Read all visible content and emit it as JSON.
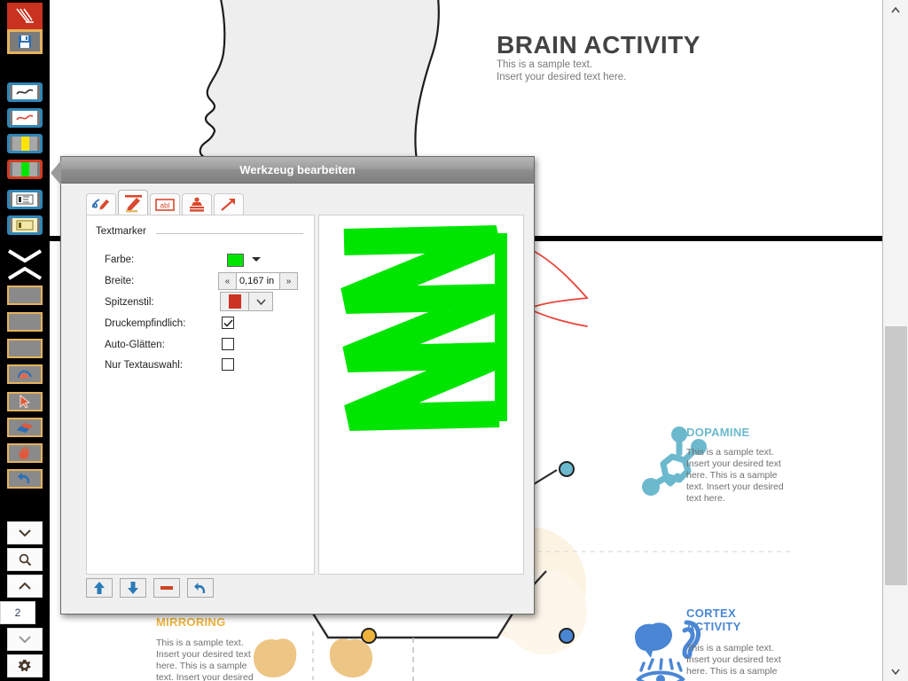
{
  "app": {
    "name": "pdf-annotator",
    "page_number": "2"
  },
  "left_toolbar": {
    "items": [
      {
        "name": "app-logo",
        "icon": "adobe-logo-icon",
        "label": "Adobe",
        "selected": false
      },
      {
        "name": "save-button",
        "icon": "floppy-disk-icon",
        "label": "Speichern",
        "selected": false
      },
      {
        "name": "pen-black-tool",
        "icon": "pen-stroke-icon",
        "label": "Stift schwarz",
        "selected": false
      },
      {
        "name": "pen-red-tool",
        "icon": "pen-stroke-icon",
        "label": "Stift rot",
        "selected": false
      },
      {
        "name": "highlighter-yellow",
        "icon": "highlighter-icon",
        "label": "Textmarker gelb",
        "selected": false
      },
      {
        "name": "highlighter-green",
        "icon": "highlighter-icon",
        "label": "Textmarker grün",
        "selected": true
      },
      {
        "name": "textbox-tool",
        "icon": "text-box-icon",
        "label": "Textfeld",
        "selected": false
      },
      {
        "name": "note-tool",
        "icon": "sticky-note-icon",
        "label": "Notiz",
        "selected": false
      },
      {
        "name": "collapse-up-chevron",
        "icon": "chevron-down-icon",
        "label": "Einklappen",
        "selected": false
      },
      {
        "name": "expand-chevron",
        "icon": "chevron-up-icon",
        "label": "Ausklappen",
        "selected": false
      },
      {
        "name": "tool-slot-1",
        "icon": "blank-tool-icon",
        "label": "Werkzeug",
        "selected": false
      },
      {
        "name": "tool-slot-2",
        "icon": "blank-tool-icon",
        "label": "Werkzeug",
        "selected": false
      },
      {
        "name": "tool-slot-3",
        "icon": "blank-tool-icon",
        "label": "Werkzeug",
        "selected": false
      },
      {
        "name": "pinch-gesture-tool",
        "icon": "pinch-hand-icon",
        "label": "Zoomgeste",
        "selected": false
      },
      {
        "name": "select-cursor-tool",
        "icon": "cursor-arrow-icon",
        "label": "Auswahl",
        "selected": false
      },
      {
        "name": "eraser-tool",
        "icon": "eraser-icon",
        "label": "Radierer",
        "selected": false
      },
      {
        "name": "pan-hand-tool",
        "icon": "hand-icon",
        "label": "Verschieben",
        "selected": false
      },
      {
        "name": "undo-tool",
        "icon": "undo-arrow-icon",
        "label": "Rückgängig",
        "selected": false
      }
    ],
    "bottom_items": [
      {
        "name": "menu-dropdown-button",
        "icon": "chevron-down-icon",
        "label": "Menü"
      },
      {
        "name": "zoom-button",
        "icon": "magnifier-icon",
        "label": "Zoom"
      },
      {
        "name": "page-up-button",
        "icon": "chevron-up-icon",
        "label": "Seite zurück"
      },
      {
        "name": "page-indicator",
        "icon": "page-number",
        "label": "2"
      },
      {
        "name": "page-down-button",
        "icon": "chevron-down-icon",
        "label": "Seite vor"
      },
      {
        "name": "settings-button",
        "icon": "gear-icon",
        "label": "Einstellungen"
      }
    ]
  },
  "document": {
    "title": "BRAIN ACTIVITY",
    "subtitle_line1": "This is a sample text.",
    "subtitle_line2": "Insert your desired text here.",
    "sections": [
      {
        "name": "dopamine",
        "heading": "DOPAMINE",
        "heading_color": "#6cb9ce",
        "body": "This is a sample text. Insert your desired text here. This is a sample text. Insert your desired text here.",
        "icon": "molecule-icon",
        "node_color": "#6cb9ce"
      },
      {
        "name": "cortex-activity",
        "heading_line1": "CORTEX",
        "heading_line2": "ACTIVITY",
        "heading_color": "#4a86d4",
        "body": "This is a sample text. Insert your desired text here. This is a sample",
        "icon": "brain-ear-eye-icon",
        "node_color": "#4a86d4"
      },
      {
        "name": "mirroring",
        "heading": "MIRRORING",
        "heading_color": "#edb33c",
        "body": "This is a sample text. Insert your desired text here. This is a sample text. Insert your desired",
        "icon": "twin-brains-icon",
        "node_color": "#edb33c"
      }
    ],
    "annotations": [
      {
        "name": "red-ink-annotation",
        "color": "#e8453c",
        "tool": "pen"
      }
    ]
  },
  "dialog": {
    "title": "Werkzeug bearbeiten",
    "tabs": [
      {
        "name": "tab-pen",
        "icon": "pen-icon",
        "label": "Stift",
        "active": false
      },
      {
        "name": "tab-highlighter",
        "icon": "highlighter-icon",
        "label": "Textmarker",
        "active": true
      },
      {
        "name": "tab-textbox",
        "icon": "text-box-icon",
        "label": "Textfeld",
        "active": false
      },
      {
        "name": "tab-stamp",
        "icon": "stamp-icon",
        "label": "Stempel",
        "active": false
      },
      {
        "name": "tab-arrow",
        "icon": "arrow-icon",
        "label": "Pfeil",
        "active": false
      }
    ],
    "group_label": "Textmarker",
    "fields": {
      "color": {
        "label": "Farbe:",
        "value": "#00e500",
        "dropdown_icon": "caret-down-icon"
      },
      "width": {
        "label": "Breite:",
        "value": "0,167 in",
        "decrement_label": "«",
        "increment_label": "»"
      },
      "tip_style": {
        "label": "Spitzenstil:",
        "value": "#cc3322",
        "dropdown_icon": "chevron-down-icon"
      },
      "pressure_sensitive": {
        "label": "Druckempfindlich:",
        "checked": true,
        "check_glyph": "✓"
      },
      "auto_smooth": {
        "label": "Auto-Glätten:",
        "checked": false,
        "check_glyph": ""
      },
      "text_selection_only": {
        "label": "Nur Textauswahl:",
        "checked": false,
        "check_glyph": ""
      }
    },
    "preview": {
      "name": "stroke-preview",
      "stroke_color": "#00e500",
      "shape": "zigzag"
    },
    "footer_buttons": [
      {
        "name": "move-up-button",
        "icon": "arrow-up-icon",
        "label": "Nach oben",
        "color": "#2b7ab8"
      },
      {
        "name": "move-down-button",
        "icon": "arrow-down-icon",
        "label": "Nach unten",
        "color": "#2b7ab8"
      },
      {
        "name": "remove-button",
        "icon": "minus-icon",
        "label": "Entfernen",
        "color": "#cc4422"
      },
      {
        "name": "reset-button",
        "icon": "undo-arrow-icon",
        "label": "Zurücksetzen",
        "color": "#2b7ab8"
      }
    ]
  },
  "scrollbar": {
    "up_label": "▲",
    "down_label": "▼",
    "name": "vertical-scrollbar"
  }
}
